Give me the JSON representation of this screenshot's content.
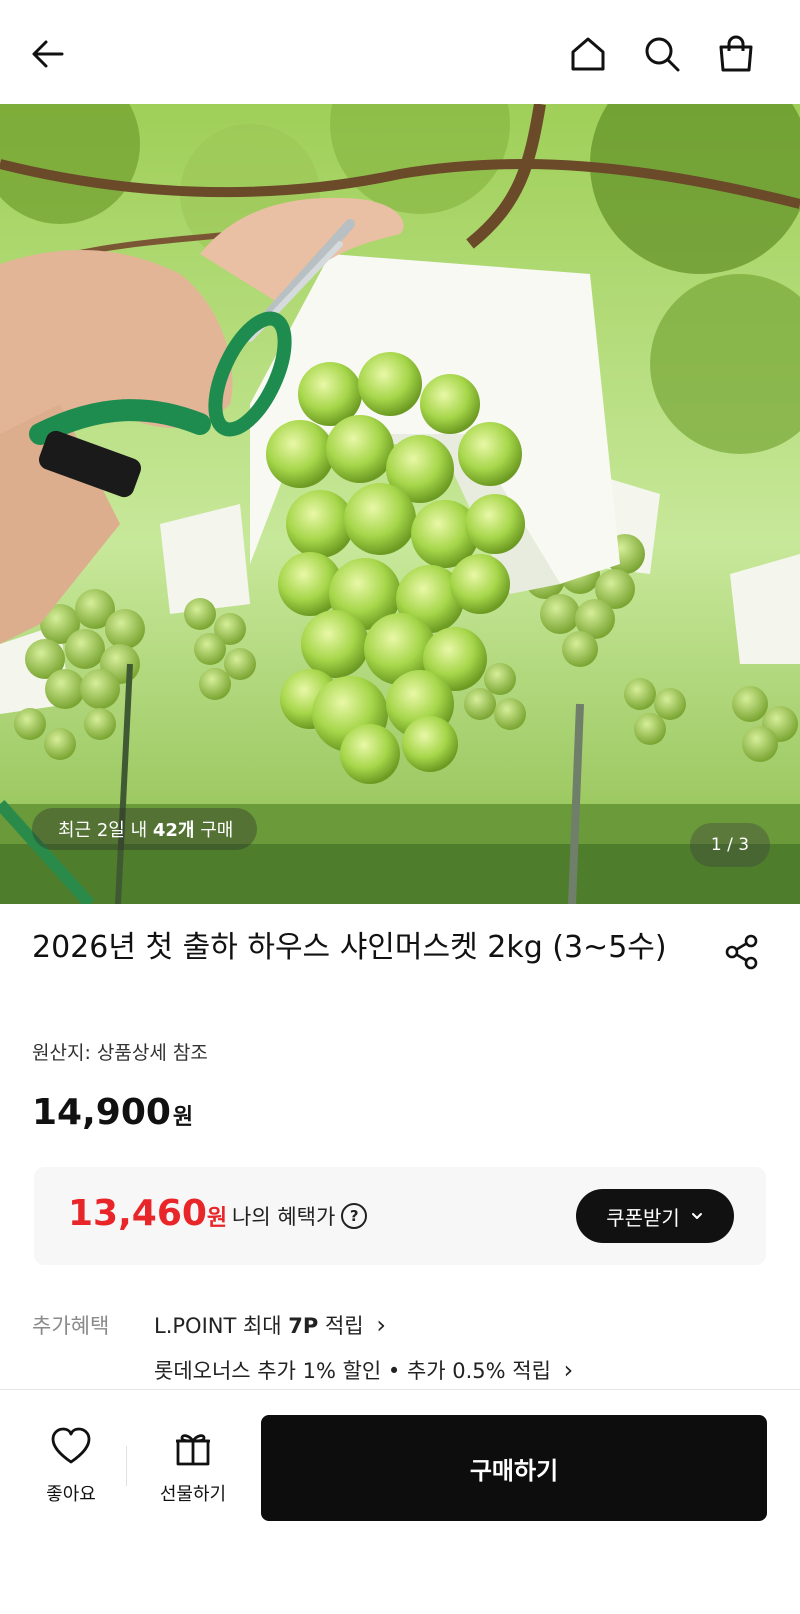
{
  "header": {
    "back_icon": "arrow-left-icon",
    "home_icon": "home-icon",
    "search_icon": "search-icon",
    "cart_icon": "shopping-bag-icon"
  },
  "gallery": {
    "recent_prefix": "최근 2일 내 ",
    "recent_count": "42개",
    "recent_suffix": " 구매",
    "page_indicator": "1 / 3",
    "image_subject": "shine-muscat-grapes-photo"
  },
  "product": {
    "title": "2026년 첫 출하 하우스 샤인머스켓 2kg (3~5수)",
    "share_icon": "share-icon",
    "origin": "원산지: 상품상세 참조",
    "price": "14,900",
    "price_unit": "원"
  },
  "benefit": {
    "price": "13,460",
    "price_unit": "원",
    "label": "나의 혜택가",
    "help_icon": "?",
    "coupon_button": "쿠폰받기",
    "accent_color": "#e8262a"
  },
  "extra_benefits": {
    "label": "추가혜택",
    "line1_prefix": "L.POINT 최대 ",
    "line1_points": "7P",
    "line1_suffix": " 적립",
    "line1_chevron": "›",
    "line2": "롯데오너스 추가 1% 할인 • 추가 0.5% 적립",
    "line2_chevron": "›"
  },
  "bottom_bar": {
    "like_label": "좋아요",
    "gift_label": "선물하기",
    "buy_label": "구매하기"
  }
}
